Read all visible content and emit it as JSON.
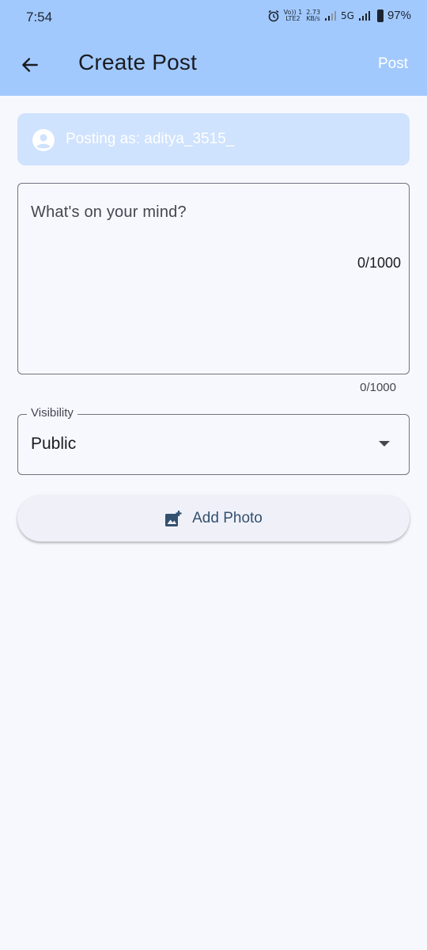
{
  "status_bar": {
    "time": "7:54",
    "volte_top": "Vo)) 1",
    "volte_bottom": "LTE2",
    "speed_value": "2.73",
    "speed_unit": "KB/s",
    "network": "5G",
    "battery": "97%"
  },
  "app_bar": {
    "title": "Create Post",
    "post_label": "Post",
    "back_icon": "arrow-left-icon"
  },
  "posting_as": {
    "text": "Posting as: aditya_3515_",
    "icon": "account-circle-icon"
  },
  "post_input": {
    "placeholder": "What's on your mind?",
    "value": "",
    "counter": "0/1000",
    "helper_counter": "0/1000"
  },
  "visibility": {
    "label": "Visibility",
    "selected": "Public",
    "icon": "dropdown-arrow-icon"
  },
  "add_photo": {
    "label": "Add Photo",
    "icon": "add-photo-icon"
  },
  "colors": {
    "app_bar": "#a2c9fd",
    "background": "#f7f8fe",
    "posting_as_bg": "#cfe2fe",
    "accent_text": "#33506f"
  }
}
